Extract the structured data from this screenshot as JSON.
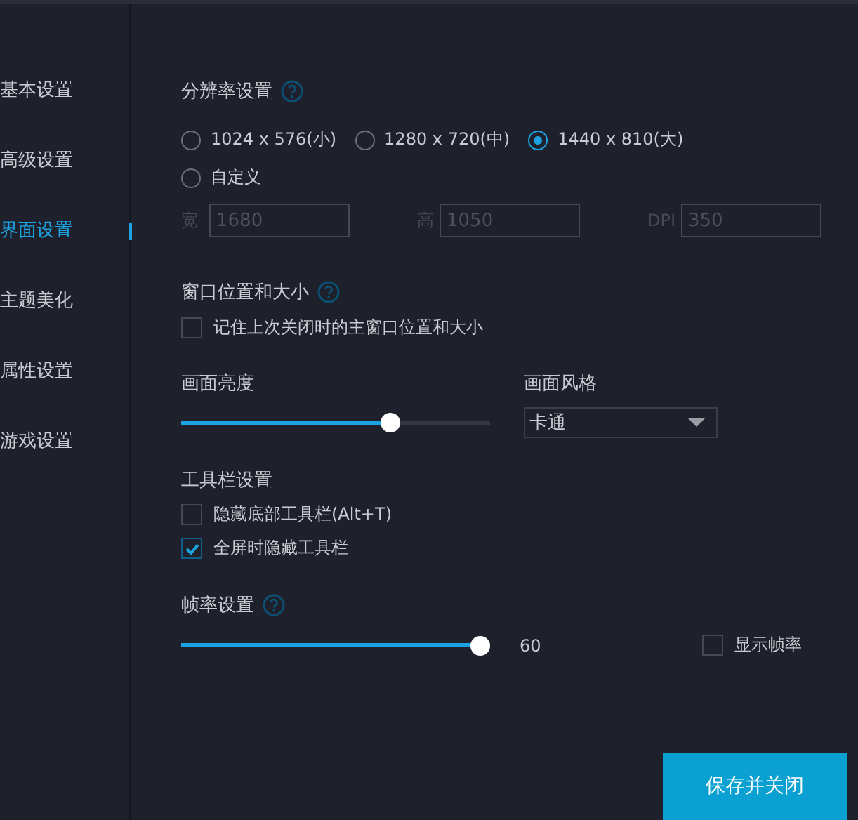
{
  "sidebar": {
    "items": [
      {
        "label": "基本设置",
        "selected": false
      },
      {
        "label": "高级设置",
        "selected": false
      },
      {
        "label": "界面设置",
        "selected": true
      },
      {
        "label": "主题美化",
        "selected": false
      },
      {
        "label": "属性设置",
        "selected": false
      },
      {
        "label": "游戏设置",
        "selected": false
      }
    ]
  },
  "resolution": {
    "title": "分辨率设置",
    "options": [
      {
        "label": "1024 x 576(小)",
        "selected": false
      },
      {
        "label": "1280 x 720(中)",
        "selected": false
      },
      {
        "label": "1440 x 810(大)",
        "selected": true
      },
      {
        "label": "自定义",
        "selected": false
      }
    ],
    "fields": [
      {
        "label": "宽",
        "value": "1680"
      },
      {
        "label": "高",
        "value": "1050"
      },
      {
        "label": "DPI",
        "value": "350"
      }
    ]
  },
  "window_position": {
    "title": "窗口位置和大小",
    "checkbox": {
      "label": "记住上次关闭时的主窗口位置和大小",
      "checked": false
    }
  },
  "brightness": {
    "title": "画面亮度",
    "level": 0.69
  },
  "style": {
    "title": "画面风格",
    "value": "卡通"
  },
  "toolbar": {
    "title": "工具栏设置",
    "checkboxes": [
      {
        "label": "隐藏底部工具栏(Alt+T)",
        "checked": false
      },
      {
        "label": "全屏时隐藏工具栏",
        "checked": true
      }
    ]
  },
  "frame_rate": {
    "title": "帧率设置",
    "level": 1,
    "reading": "60",
    "show_checkbox": {
      "label": "显示帧率",
      "checked": false
    }
  },
  "save_button": "保存并关闭"
}
